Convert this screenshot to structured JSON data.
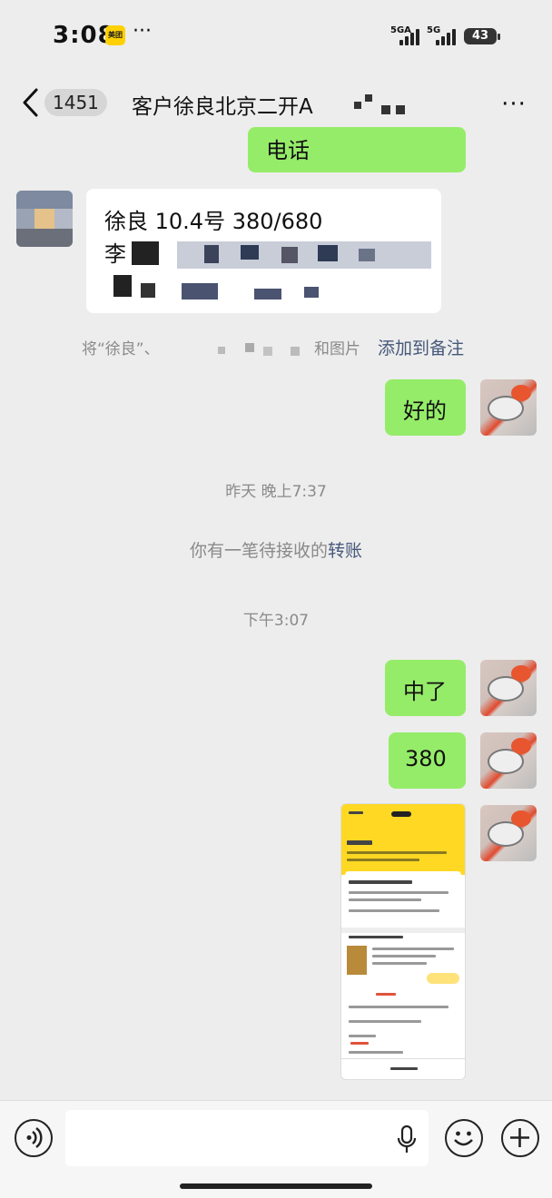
{
  "status": {
    "time": "3:08",
    "app_badge": "美团",
    "more": "···",
    "net1": "5GA",
    "net2": "5G",
    "battery": "43"
  },
  "nav": {
    "back_count": "1451",
    "title": "客户徐良北京二开A",
    "more": "···"
  },
  "messages": {
    "phone_partial": "电话",
    "contact_line1": "徐良 10.4号 380/680",
    "contact_line2_prefix": "李",
    "system_note_prefix": "将“徐良”、",
    "system_note_suffix": "和图片",
    "system_note_link": "添加到备注",
    "reply_ok": "好的",
    "timestamp1": "昨天 晚上7:37",
    "transfer_prefix": "你有一笔待接收的",
    "transfer_link": "转账",
    "timestamp2": "下午3:07",
    "reply_win": "中了",
    "reply_amount": "380"
  },
  "input": {
    "placeholder": ""
  },
  "colors": {
    "bg": "#ededed",
    "bubble_me": "#95ec69",
    "bubble_other": "#ffffff",
    "link": "#46587a"
  }
}
